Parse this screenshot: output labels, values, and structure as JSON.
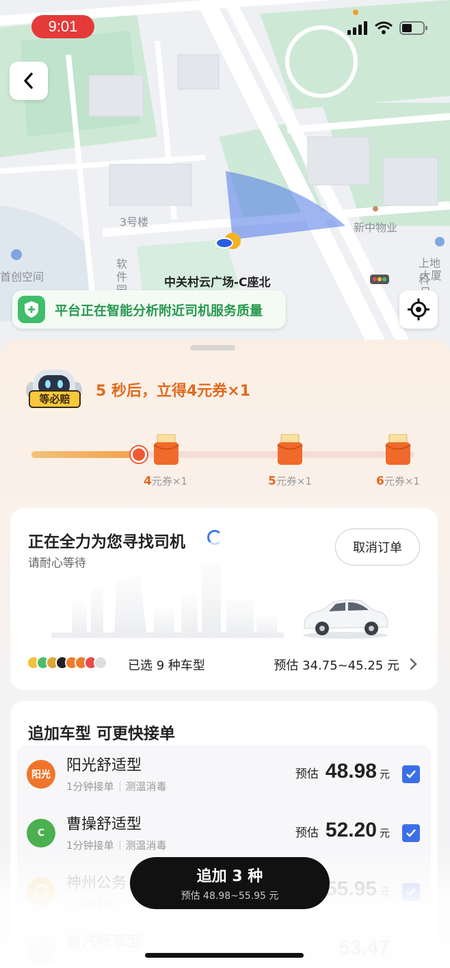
{
  "status_bar": {
    "time": "9:01"
  },
  "map": {
    "labels": {
      "building3": "3号楼",
      "software_park": "软件园",
      "xinzhong": "新中物业",
      "shangdi": "上地科",
      "dasha": "大厦日",
      "kongjian": "首创空间"
    },
    "poi": "中关村云广场-C座北",
    "quality_banner": "平台正在智能分析附近司机服务质量"
  },
  "reward": {
    "robot_tag": "等必赔",
    "countdown": "5 秒后，立得4元券×1",
    "progress": 0.28,
    "coupons": [
      {
        "num": "4",
        "text": "元券×1"
      },
      {
        "num": "5",
        "text": "元券×1"
      },
      {
        "num": "6",
        "text": "元券×1"
      }
    ]
  },
  "search": {
    "title": "正在全力为您寻找司机",
    "subtitle": "请耐心等待",
    "cancel_label": "取消订单",
    "selected_types": "已选 9 种车型",
    "estimate_range": "预估 34.75~45.25 元"
  },
  "add_section": {
    "title": "追加车型 可更快接单",
    "rows": [
      {
        "name": "阳光舒适型",
        "tag1": "1分钟接单",
        "tag2": "测温消毒",
        "pre": "预估",
        "price": "48.98",
        "unit": "元",
        "icon_text": "阳光"
      },
      {
        "name": "曹操舒适型",
        "tag1": "1分钟接单",
        "tag2": "测温消毒",
        "pre": "预估",
        "price": "52.20",
        "unit": "元",
        "icon_text": "C"
      },
      {
        "name": "神州公务",
        "tag1": "1分钟接单",
        "tag2": "",
        "pre": "",
        "price": "55.95",
        "unit": "元",
        "icon_text": ""
      },
      {
        "name": "首汽畅享型",
        "tag1": "",
        "tag2": "",
        "pre": "",
        "price": "53.47",
        "unit": "",
        "icon_text": ""
      }
    ]
  },
  "cta": {
    "main": "追加 3 种",
    "sub": "预估 48.98~55.95 元"
  },
  "colors": {
    "accent_orange": "#e06a1f",
    "checkbox_blue": "#3a6fe8",
    "shield_green": "#3fbd6a",
    "time_red": "#e53a3a"
  }
}
